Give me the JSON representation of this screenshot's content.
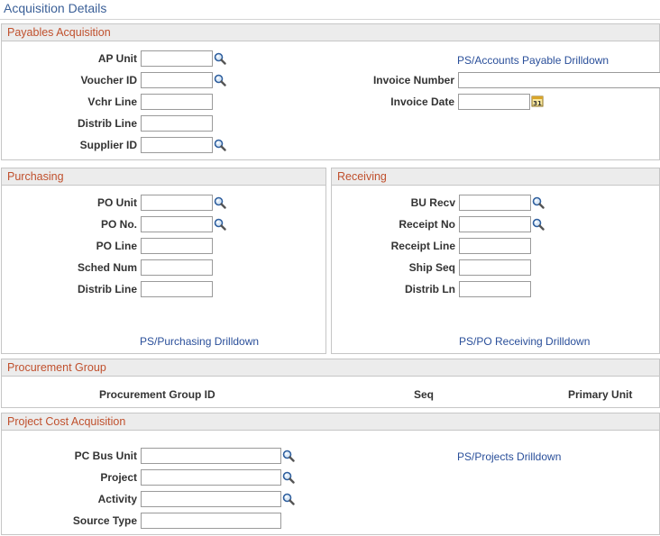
{
  "page": {
    "title": "Acquisition Details"
  },
  "payables": {
    "header": "Payables Acquisition",
    "labels": {
      "ap_unit": "AP Unit",
      "voucher_id": "Voucher ID",
      "vchr_line": "Vchr Line",
      "distrib_line": "Distrib Line",
      "supplier_id": "Supplier ID",
      "invoice_number": "Invoice Number",
      "invoice_date": "Invoice Date"
    },
    "values": {
      "ap_unit": "",
      "voucher_id": "",
      "vchr_line": "",
      "distrib_line": "",
      "supplier_id": "",
      "invoice_number": "",
      "invoice_date": ""
    },
    "drilldown": "PS/Accounts Payable Drilldown"
  },
  "purchasing": {
    "header": "Purchasing",
    "labels": {
      "po_unit": "PO Unit",
      "po_no": "PO No.",
      "po_line": "PO Line",
      "sched_num": "Sched Num",
      "distrib_line": "Distrib Line"
    },
    "values": {
      "po_unit": "",
      "po_no": "",
      "po_line": "",
      "sched_num": "",
      "distrib_line": ""
    },
    "drilldown": "PS/Purchasing Drilldown"
  },
  "receiving": {
    "header": "Receiving",
    "labels": {
      "bu_recv": "BU Recv",
      "receipt_no": "Receipt No",
      "receipt_line": "Receipt Line",
      "ship_seq": "Ship Seq",
      "distrib_ln": "Distrib Ln"
    },
    "values": {
      "bu_recv": "",
      "receipt_no": "",
      "receipt_line": "",
      "ship_seq": "",
      "distrib_ln": ""
    },
    "drilldown": "PS/PO Receiving Drilldown"
  },
  "procurement": {
    "header": "Procurement Group",
    "columns": {
      "group_id": "Procurement Group ID",
      "seq": "Seq",
      "primary_unit": "Primary Unit"
    }
  },
  "project": {
    "header": "Project Cost Acquisition",
    "labels": {
      "pc_bus_unit": "PC Bus Unit",
      "project": "Project",
      "activity": "Activity",
      "source_type": "Source Type"
    },
    "values": {
      "pc_bus_unit": "",
      "project": "",
      "activity": "",
      "source_type": ""
    },
    "drilldown": "PS/Projects Drilldown"
  },
  "icons": {
    "lookup": "magnifier-lookup-icon",
    "calendar": "calendar-icon"
  },
  "colors": {
    "section_header_text": "#c0502d",
    "link": "#2a4f9a",
    "title": "#3a5f97",
    "header_bg": "#ececec"
  }
}
